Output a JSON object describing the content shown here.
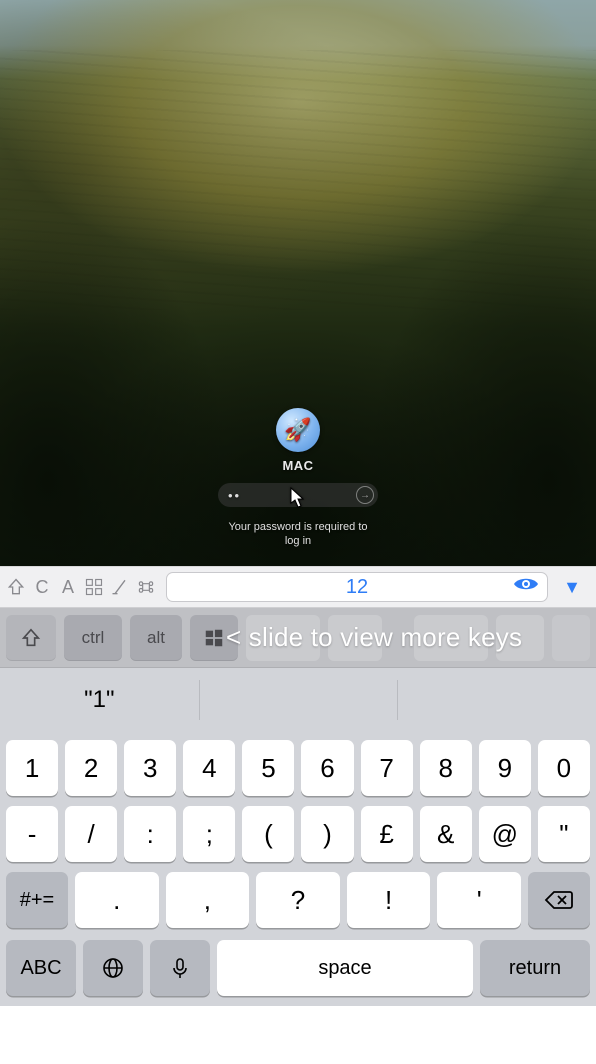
{
  "remote": {
    "avatar_emoji": "🚀",
    "username": "MAC",
    "password_mask": "••",
    "submit_glyph": "→",
    "hint_line1": "Your password is required to",
    "hint_line2": "log in"
  },
  "toolbar": {
    "icons": {
      "shift": "⇧",
      "c": "C",
      "a": "A",
      "grid": "⌘",
      "slash": "⟋",
      "cmd": "⌘"
    },
    "field_value": "12",
    "caret": "▼"
  },
  "mod_rail": {
    "shift": "⇧",
    "ctrl": "ctrl",
    "alt": "alt",
    "slide_hint": "< slide to view more keys"
  },
  "keyboard": {
    "suggestions": [
      "\"1\"",
      "",
      ""
    ],
    "row1": [
      "1",
      "2",
      "3",
      "4",
      "5",
      "6",
      "7",
      "8",
      "9",
      "0"
    ],
    "row2": [
      "-",
      "/",
      ":",
      ";",
      "(",
      ")",
      "£",
      "&",
      "@",
      "\""
    ],
    "row3_left": "#+=",
    "row3": [
      ".",
      ",",
      "?",
      "!",
      "'"
    ],
    "row3_right_icon": "backspace",
    "bottom": {
      "abc": "ABC",
      "globe_icon": "globe",
      "mic_icon": "mic",
      "space": "space",
      "return": "return"
    }
  }
}
